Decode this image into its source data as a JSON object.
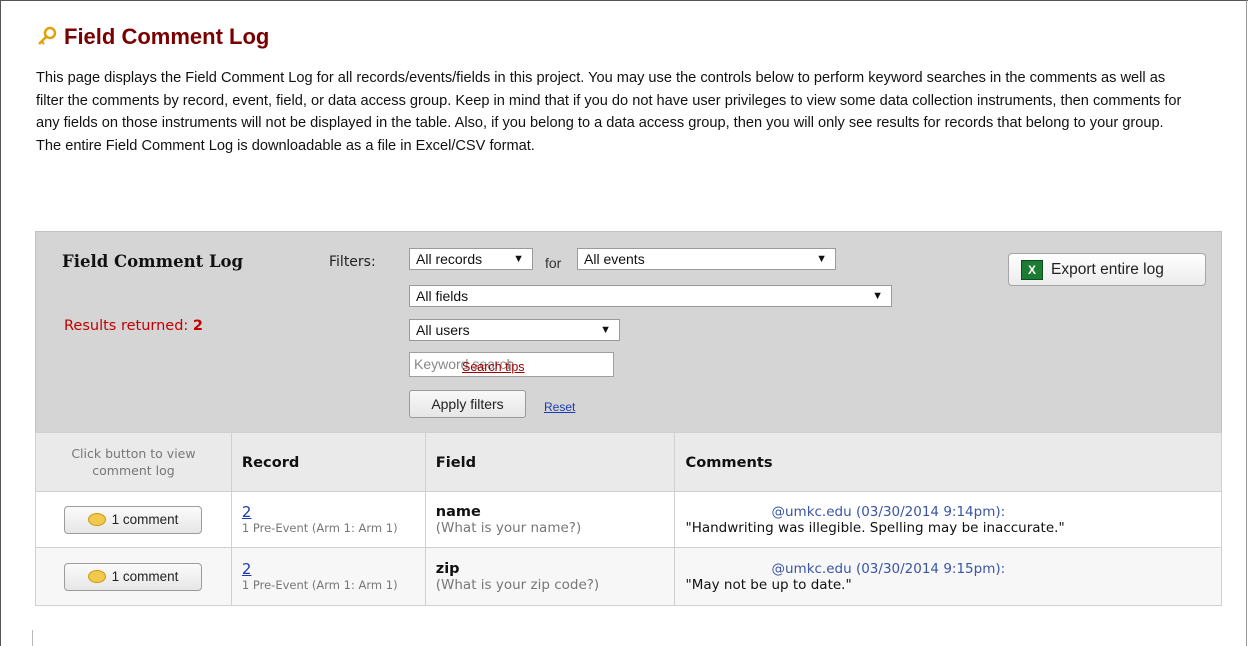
{
  "page": {
    "title": "Field Comment Log",
    "description": "This page displays the Field Comment Log for all records/events/fields in this project. You may use the controls below to perform keyword searches in the comments as well as filter the comments by record, event, field, or data access group. Keep in mind that if you do not have user privileges to view some data collection instruments, then comments for any fields on those instruments will not be displayed in the table. Also, if you belong to a data access group, then you will only see results for records that belong to your group. The entire Field Comment Log is downloadable as a file in Excel/CSV format."
  },
  "panel": {
    "title": "Field Comment Log",
    "results_label": "Results returned:",
    "results_count": "2",
    "filters_label": "Filters:",
    "records_select": "All records",
    "for_label": "for",
    "events_select": "All events",
    "fields_select": "All fields",
    "users_select": "All users",
    "keyword_placeholder": "Keyword search",
    "search_tips": "Search tips",
    "apply_button": "Apply filters",
    "reset_link": "Reset",
    "export_button": "Export entire log"
  },
  "table": {
    "headers": {
      "button_col": "Click button to view comment log",
      "record": "Record",
      "field": "Field",
      "comments": "Comments"
    },
    "rows": [
      {
        "button": "1 comment",
        "record": "2",
        "event": "1 Pre-Event (Arm 1: Arm 1)",
        "field_name": "name",
        "field_label": "(What is your name?)",
        "comment_author": "@umkc.edu (03/30/2014 9:14pm):",
        "comment_text": "\"Handwriting was illegible. Spelling may be inaccurate.\""
      },
      {
        "button": "1 comment",
        "record": "2",
        "event": "1 Pre-Event (Arm 1: Arm 1)",
        "field_name": "zip",
        "field_label": "(What is your zip code?)",
        "comment_author": "@umkc.edu (03/30/2014 9:15pm):",
        "comment_text": "\"May not be up to date.\""
      }
    ]
  },
  "colors": {
    "title": "#7a0000",
    "results": "#c00000",
    "link": "#1a3cb0",
    "panel_bg": "#d5d5d5"
  }
}
